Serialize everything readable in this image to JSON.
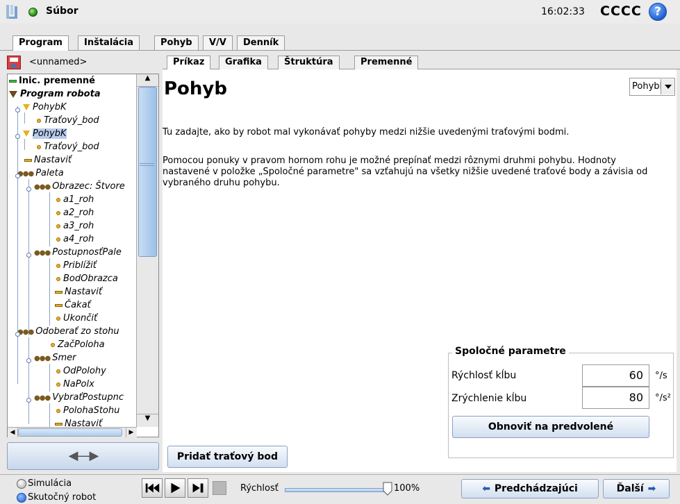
{
  "header": {
    "file_label": "Súbor",
    "clock": "16:02:33",
    "robot_name": "CCCC",
    "help": "?"
  },
  "main_tabs": [
    "Program",
    "Inštalácia",
    "Pohyb",
    "V/V",
    "Denník"
  ],
  "left": {
    "program_name": "<unnamed>",
    "tree": [
      {
        "label": "Inic. premenné",
        "icon": "bar-green-icon"
      },
      {
        "label": "Program robota",
        "icon": "triangle-icon"
      },
      {
        "label": "PohybK",
        "icon": "move-icon"
      },
      {
        "label": "Traťový_bod",
        "icon": "waypoint-icon"
      },
      {
        "label": "PohybK",
        "icon": "move-icon"
      },
      {
        "label": "Traťový_bod",
        "icon": "waypoint-icon"
      },
      {
        "label": "Nastaviť",
        "icon": "set-icon"
      },
      {
        "label": "Paleta",
        "icon": "pallet-icon"
      },
      {
        "label": "Obrazec: Štvore",
        "icon": "pattern-icon"
      },
      {
        "label": "a1_roh",
        "icon": "waypoint-icon"
      },
      {
        "label": "a2_roh",
        "icon": "waypoint-icon"
      },
      {
        "label": "a3_roh",
        "icon": "waypoint-icon"
      },
      {
        "label": "a4_roh",
        "icon": "waypoint-icon"
      },
      {
        "label": "PostupnosťPale",
        "icon": "sequence-icon"
      },
      {
        "label": "Priblížiť",
        "icon": "waypoint-icon"
      },
      {
        "label": "BodObrazca",
        "icon": "waypoint-icon"
      },
      {
        "label": "Nastaviť",
        "icon": "set-icon"
      },
      {
        "label": "Čakať",
        "icon": "wait-icon"
      },
      {
        "label": "Ukončiť",
        "icon": "waypoint-icon"
      },
      {
        "label": "Odoberať zo stohu",
        "icon": "destack-icon"
      },
      {
        "label": "ZačPoloha",
        "icon": "waypoint-icon"
      },
      {
        "label": "Smer",
        "icon": "direction-icon"
      },
      {
        "label": "OdPolohy",
        "icon": "waypoint-icon"
      },
      {
        "label": "NaPolx",
        "icon": "waypoint-icon"
      },
      {
        "label": "VybraťPostupnc",
        "icon": "sequence-icon"
      },
      {
        "label": "PolohaStohu",
        "icon": "waypoint-icon"
      },
      {
        "label": "Nastaviť",
        "icon": "set-icon"
      }
    ]
  },
  "sub_tabs": [
    "Príkaz",
    "Grafika",
    "Štruktúra",
    "Premenné"
  ],
  "content": {
    "title": "Pohyb",
    "move_type": "PohybK",
    "desc1": "Tu zadajte, ako by robot mal vykonávať pohyby medzi nižšie uvedenými traťovými bodmi.",
    "desc2": "Pomocou ponuky v pravom hornom rohu je možné prepínať medzi rôznymi druhmi pohybu. Hodnoty nastavené v položke „Spoločné parametre\" sa vzťahujú na všetky nižšie uvedené traťové body a závisia od vybraného druhu pohybu.",
    "params": {
      "legend": "Spoločné parametre",
      "speed_label": "Rýchlosť kĺbu",
      "speed_value": "60",
      "speed_unit": "°/s",
      "accel_label": "Zrýchlenie kĺbu",
      "accel_value": "80",
      "accel_unit": "°/s²",
      "reset_label": "Obnoviť na predvolené"
    },
    "add_waypoint_label": "Pridať traťový bod"
  },
  "footer": {
    "sim_label": "Simulácia",
    "real_label": "Skutočný robot",
    "speed_label": "Rýchlosť",
    "speed_value": "100%",
    "speed_fraction": 1.0,
    "prev_label": "Predchádzajúci",
    "next_label": "Ďalší"
  },
  "colors": {
    "accent": "#2a5ab0",
    "status_ok": "#2f8f1d",
    "waypoint": "#e8b020"
  }
}
